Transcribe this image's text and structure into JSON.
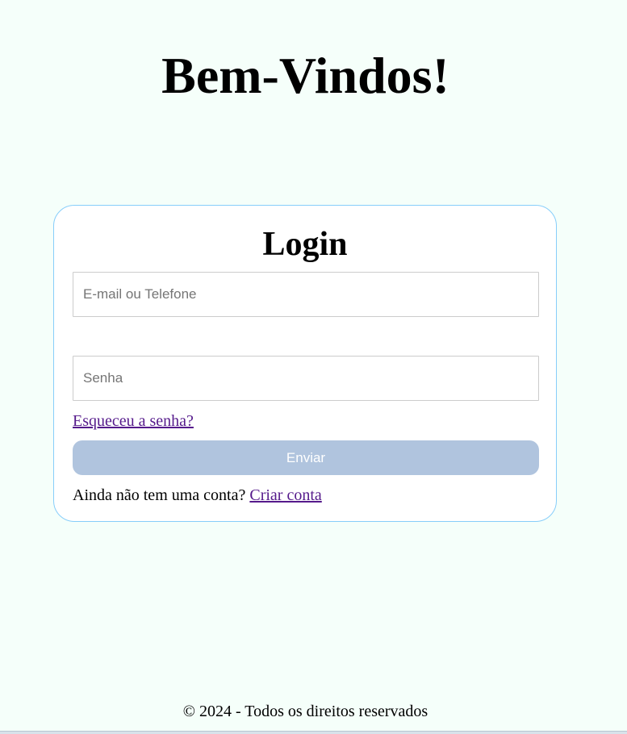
{
  "header": {
    "title": "Bem-Vindos!"
  },
  "login": {
    "title": "Login",
    "email_placeholder": "E-mail ou Telefone",
    "password_placeholder": "Senha",
    "forgot_password": "Esqueceu a senha?",
    "submit_label": "Enviar",
    "no_account_text": "Ainda não tem uma conta?",
    "create_account": "Criar conta"
  },
  "footer": {
    "text": "© 2024 - Todos os direitos reservados"
  },
  "colors": {
    "page_background": "#f5fffa",
    "card_border": "#87cefa",
    "button_background": "#b0c4de",
    "visited_link": "#551a8b"
  }
}
